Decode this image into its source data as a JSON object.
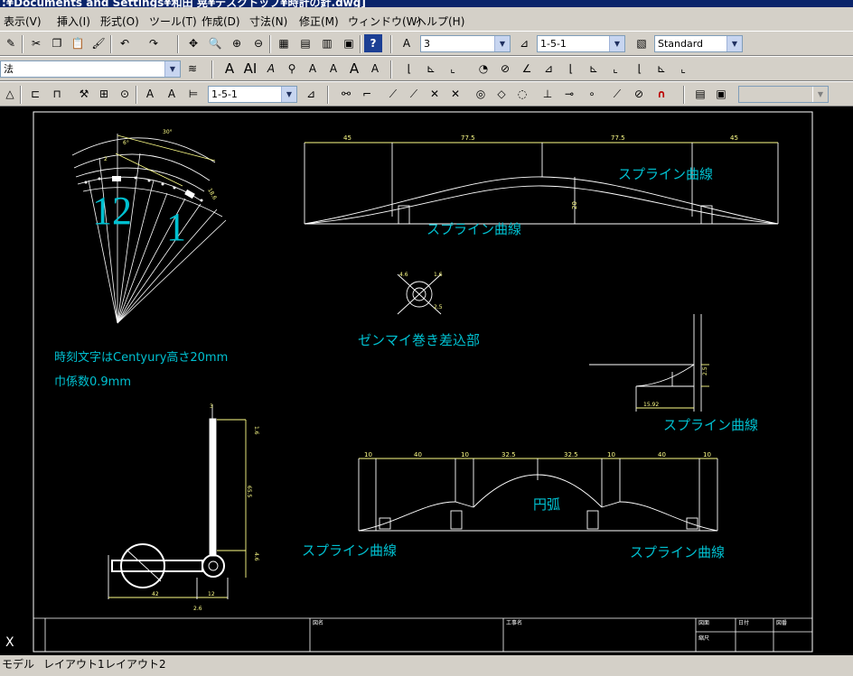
{
  "window": {
    "title": ":¥Documents and Settings¥和田 晃¥デスクトップ¥時計の針.dwg]"
  },
  "menu": [
    "表示(V)",
    "挿入(I)",
    "形式(O)",
    "ツール(T)",
    "作成(D)",
    "寸法(N)",
    "修正(M)",
    "ウィンドウ(W)",
    "ヘルプ(H)"
  ],
  "toolbar1": {
    "layer_value": "3",
    "dimstyle_value": "1-5-1",
    "textstyle_value": "Standard"
  },
  "toolbar2": {
    "layer_combo_value": "法"
  },
  "toolbar3": {
    "dimstyle_value": "1-5-1"
  },
  "drawing": {
    "numerals": [
      "12",
      "1"
    ],
    "note1": "時刻文字はCentyury高さ20mm",
    "note2": "巾係数0.9mm",
    "spline_label": "スプライン曲線",
    "winding_label": "ゼンマイ巻き差込部",
    "arc_label": "円弧",
    "dims": {
      "top_45a": "45",
      "top_77a": "77.5",
      "top_77b": "77.5",
      "top_45b": "45",
      "side_20": "20",
      "bot_10a": "10",
      "bot_40a": "40",
      "bot_10b": "10",
      "bot_325a": "32.5",
      "bot_325b": "32.5",
      "bot_10c": "10",
      "bot_40b": "40",
      "bot_10d": "10",
      "hand_3": "3",
      "hand_16": "1.6",
      "hand_655": "65.5",
      "hand_46": "4.6",
      "hand_42": "42",
      "hand_12": "12",
      "hand_26": "2.6",
      "small_1592": "15.92",
      "small_25": "2.5"
    },
    "titleblock": {
      "cell_a": "図名",
      "cell_b": "工事名",
      "cell_c": "図面",
      "cell_d": "日付",
      "cell_e": "図番",
      "cell_f": "縮尺"
    }
  },
  "ucs_icon": "X",
  "tabs": [
    "モデル",
    "レイアウト1",
    "レイアウト2"
  ],
  "colors": {
    "canvas": "#000000",
    "cyan": "#00c0d0",
    "line": "#ffffff",
    "dim": "#ffff80"
  }
}
